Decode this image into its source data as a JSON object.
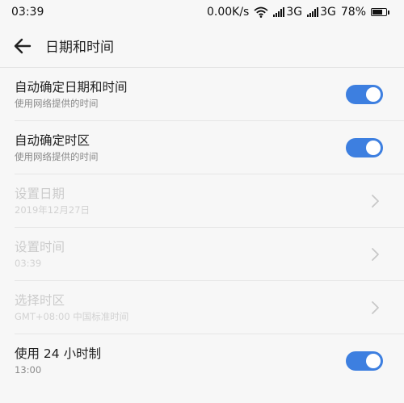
{
  "status_bar": {
    "time": "03:39",
    "net_speed": "0.00K/s",
    "sim1_type": "3G",
    "sim2_type": "3G",
    "battery_percent": "78%",
    "battery_level": 0.78
  },
  "app_bar": {
    "title": "日期和时间",
    "back_icon": "arrow-left-icon"
  },
  "settings": [
    {
      "title": "自动确定日期和时间",
      "subtitle": "使用网络提供的时间",
      "control": "toggle",
      "on": true,
      "enabled": true
    },
    {
      "title": "自动确定时区",
      "subtitle": "使用网络提供的时间",
      "control": "toggle",
      "on": true,
      "enabled": true
    },
    {
      "title": "设置日期",
      "subtitle": "2019年12月27日",
      "control": "chevron",
      "enabled": false
    },
    {
      "title": "设置时间",
      "subtitle": "03:39",
      "control": "chevron",
      "enabled": false
    },
    {
      "title": "选择时区",
      "subtitle": "GMT+08:00 中国标准时间",
      "control": "chevron",
      "enabled": false
    },
    {
      "title": "使用 24 小时制",
      "subtitle": "13:00",
      "control": "toggle",
      "on": true,
      "enabled": true
    }
  ],
  "colors": {
    "accent": "#3d7fe0",
    "background": "#f7f7f7",
    "divider": "#e6e6e6",
    "disabled_text": "#cbcbcb",
    "chevron": "#c8c8c8"
  }
}
